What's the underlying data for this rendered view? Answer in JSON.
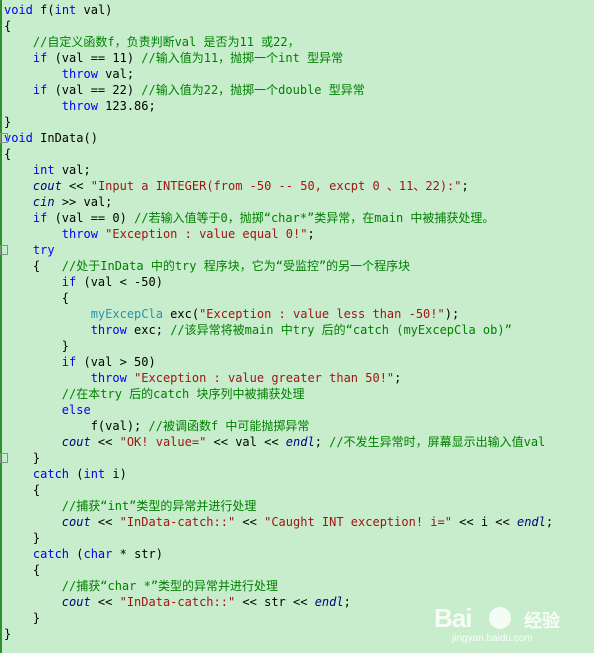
{
  "colors": {
    "background": "#c7edcc",
    "text": "#000000",
    "keyword": "#0000ff",
    "comment": "#008000",
    "string": "#a31515",
    "italic_object": "#000080",
    "class_name": "#2b91af",
    "squiggle": "#ff0000"
  },
  "code_lines": [
    [
      [
        "kw",
        "void"
      ],
      [
        "p",
        " f("
      ],
      [
        "kw",
        "int"
      ],
      [
        "p",
        " val)"
      ]
    ],
    [
      [
        "p",
        "{"
      ]
    ],
    [
      [
        "p",
        "    "
      ],
      [
        "cm",
        "//自定义函数f，负责判断val 是否为11 或22，"
      ]
    ],
    [
      [
        "p",
        "    "
      ],
      [
        "kw",
        "if"
      ],
      [
        "p",
        " (val == 11) "
      ],
      [
        "cm",
        "//输入值为11，抛掷一个int 型异常"
      ]
    ],
    [
      [
        "p",
        "        "
      ],
      [
        "kw",
        "throw"
      ],
      [
        "p",
        " val;"
      ]
    ],
    [
      [
        "p",
        "    "
      ],
      [
        "kw",
        "if"
      ],
      [
        "p",
        " (val == 22) "
      ],
      [
        "cm",
        "//输入值为22，抛掷一个double 型异常"
      ]
    ],
    [
      [
        "p",
        "        "
      ],
      [
        "kw",
        "throw"
      ],
      [
        "p",
        " 123.86;"
      ]
    ],
    [
      [
        "p",
        "}"
      ]
    ],
    [
      [
        "kw",
        "void"
      ],
      [
        "p",
        " InData()"
      ]
    ],
    [
      [
        "p",
        "{"
      ]
    ],
    [
      [
        "p",
        "    "
      ],
      [
        "kw",
        "int"
      ],
      [
        "p",
        " val;"
      ]
    ],
    [
      [
        "p",
        "    "
      ],
      [
        "it",
        "cout"
      ],
      [
        "p",
        " << "
      ],
      [
        "st",
        "\"Input a INTEGER(from -50 -- 50, excpt 0 、11、22):\""
      ],
      [
        "p",
        ";"
      ]
    ],
    [
      [
        "p",
        "    "
      ],
      [
        "it",
        "cin"
      ],
      [
        "p",
        " >> val;"
      ]
    ],
    [
      [
        "p",
        "    "
      ],
      [
        "kw",
        "if"
      ],
      [
        "p",
        " (val == 0) "
      ],
      [
        "cm",
        "//若输入值等于0，抛掷“char*”类异常，在main 中被捕获处理。"
      ]
    ],
    [
      [
        "p",
        "        "
      ],
      [
        "kw",
        "throw"
      ],
      [
        "p",
        " "
      ],
      [
        "st",
        "\"Exception : value equal 0!\""
      ],
      [
        "p",
        ";"
      ]
    ],
    [
      [
        "p",
        "    "
      ],
      [
        "kw",
        "try"
      ]
    ],
    [
      [
        "p",
        "    {   "
      ],
      [
        "cm",
        "//处于InData 中的try 程序块，它为“受监控”的另一个程序块"
      ]
    ],
    [
      [
        "p",
        "        "
      ],
      [
        "kw",
        "if"
      ],
      [
        "p",
        " (val < -50)"
      ]
    ],
    [
      [
        "p",
        "        {"
      ]
    ],
    [
      [
        "p",
        "            "
      ],
      [
        "cl",
        "myExcepCla"
      ],
      [
        "p",
        " exc("
      ],
      [
        "st",
        "\"Exception : value less than -50!\""
      ],
      [
        "p",
        ");"
      ]
    ],
    [
      [
        "p",
        "            "
      ],
      [
        "kw",
        "throw"
      ],
      [
        "p",
        " exc; "
      ],
      [
        "cm",
        "//该异常将被main 中try 后的“catch (myExcepCla ob)”"
      ]
    ],
    [
      [
        "p",
        "        }"
      ]
    ],
    [
      [
        "p",
        "        "
      ],
      [
        "kw",
        "if"
      ],
      [
        "p",
        " (val > 50)"
      ]
    ],
    [
      [
        "p",
        "            "
      ],
      [
        "kw",
        "throw"
      ],
      [
        "p",
        " "
      ],
      [
        "st",
        "\"Exception : value greater than 50!\""
      ],
      [
        "p",
        ";"
      ]
    ],
    [
      [
        "p",
        "        "
      ],
      [
        "cm",
        "//在本try 后的catch 块序列中被捕获处理"
      ]
    ],
    [
      [
        "p",
        "        "
      ],
      [
        "kw",
        "else"
      ]
    ],
    [
      [
        "p",
        "            f(val); "
      ],
      [
        "cm",
        "//被调函数f 中可能抛掷异常"
      ]
    ],
    [
      [
        "p",
        "        "
      ],
      [
        "it",
        "cout"
      ],
      [
        "p",
        " << "
      ],
      [
        "st",
        "\"OK! value=\""
      ],
      [
        "p",
        " << val << "
      ],
      [
        "it",
        "endl"
      ],
      [
        "p",
        "; "
      ],
      [
        "cm",
        "//不发生异常时，屏幕显示出输入值val"
      ]
    ],
    [
      [
        "p",
        "    }"
      ]
    ],
    [
      [
        "p",
        "    "
      ],
      [
        "kw",
        "catch"
      ],
      [
        "p",
        " ("
      ],
      [
        "kw",
        "int"
      ],
      [
        "p",
        " i)"
      ]
    ],
    [
      [
        "p",
        "    {"
      ]
    ],
    [
      [
        "p",
        "        "
      ],
      [
        "cm",
        "//捕获“int”类型的异常并进行处理"
      ]
    ],
    [
      [
        "p",
        "        "
      ],
      [
        "it",
        "cout"
      ],
      [
        "p",
        " << "
      ],
      [
        "st",
        "\"InData-catch::\""
      ],
      [
        "p",
        " << "
      ],
      [
        "st",
        "\"Caught INT exception! i=\""
      ],
      [
        "p",
        " << i << "
      ],
      [
        "it",
        "endl"
      ],
      [
        "p",
        ";"
      ]
    ],
    [
      [
        "p",
        "    }"
      ]
    ],
    [
      [
        "p",
        "    "
      ],
      [
        "kw",
        "catch"
      ],
      [
        "p",
        " ("
      ],
      [
        "kw",
        "char"
      ],
      [
        "p",
        " * str)"
      ]
    ],
    [
      [
        "p",
        "    {"
      ]
    ],
    [
      [
        "p",
        "        "
      ],
      [
        "cm",
        "//捕获“char *”类型的异常并进行处理"
      ]
    ],
    [
      [
        "p",
        "        "
      ],
      [
        "it",
        "cout"
      ],
      [
        "p",
        " << "
      ],
      [
        "st",
        "\"InData-catch::\""
      ],
      [
        "p",
        " << str << "
      ],
      [
        "it",
        "endl"
      ],
      [
        "p",
        ";"
      ]
    ],
    [
      [
        "p",
        "    }"
      ]
    ],
    [
      [
        "p",
        "}"
      ]
    ]
  ],
  "fold_marker_lines": [
    8,
    15,
    28
  ],
  "watermark": {
    "logo_text": "Bai",
    "sub_text": "经验",
    "url": "jingyan.baidu.com"
  }
}
